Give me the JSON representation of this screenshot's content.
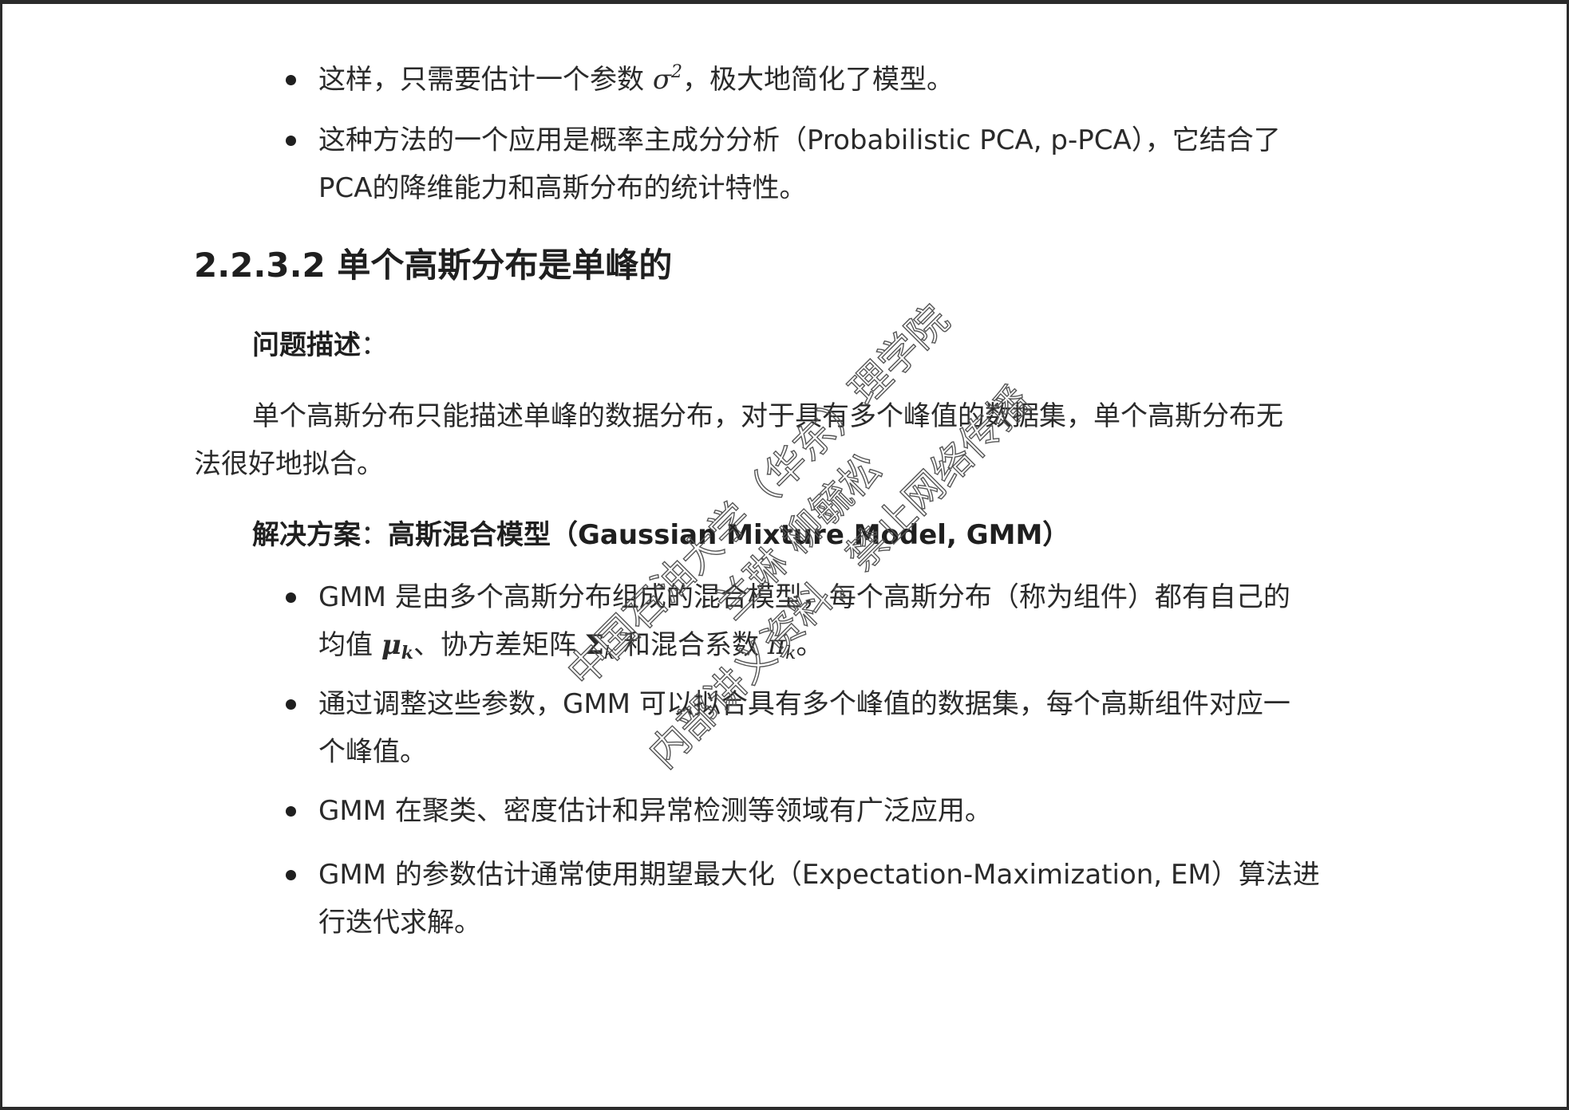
{
  "bullets_top": [
    {
      "line1_prefix": "这样，只需要估计一个参数 ",
      "math": "σ",
      "math_sup": "2",
      "line1_suffix": "，极大地简化了模型。"
    },
    {
      "line1": "这种方法的一个应用是概率主成分分析（Probabilistic PCA, p-PCA），它结合了",
      "line2": "PCA的降维能力和高斯分布的统计特性。"
    }
  ],
  "heading": "2.2.3.2 单个高斯分布是单峰的",
  "problem": {
    "label": "问题描述",
    "colon": "：",
    "line1": "单个高斯分布只能描述单峰的数据分布，对于具有多个峰值的数据集，单个高斯分布无",
    "line2": "法很好地拟合。"
  },
  "solution": {
    "label": "解决方案",
    "colon": "：",
    "value": "高斯混合模型（Gaussian Mixture Model, GMM）"
  },
  "bullets_bottom": [
    {
      "line1": "GMM 是由多个高斯分布组成的混合模型，每个高斯分布（称为组件）都有自己的",
      "line2_prefix": "均值 ",
      "mu": "μ",
      "mu_sub": "k",
      "line2_mid1": "、协方差矩阵 ",
      "sigma": "Σ",
      "sigma_sub": "k",
      "line2_mid2": " 和混合系数 ",
      "pi": "π",
      "pi_sub": "k",
      "line2_suffix": "。"
    },
    {
      "line1": "通过调整这些参数，GMM 可以拟合具有多个峰值的数据集，每个高斯组件对应一",
      "line2": "个峰值。"
    },
    {
      "line1": "GMM 在聚类、密度估计和异常检测等领域有广泛应用。"
    },
    {
      "line1": "GMM 的参数估计通常使用期望最大化（Expectation-Maximization, EM）算法进",
      "line2": "行迭代求解。"
    }
  ],
  "watermark": {
    "line1": "中国石油大学（华东）理学院",
    "line2": "兰琳 柳毓松",
    "line3": "内部讲义资料，禁止网络传播",
    "color": "#555555"
  }
}
